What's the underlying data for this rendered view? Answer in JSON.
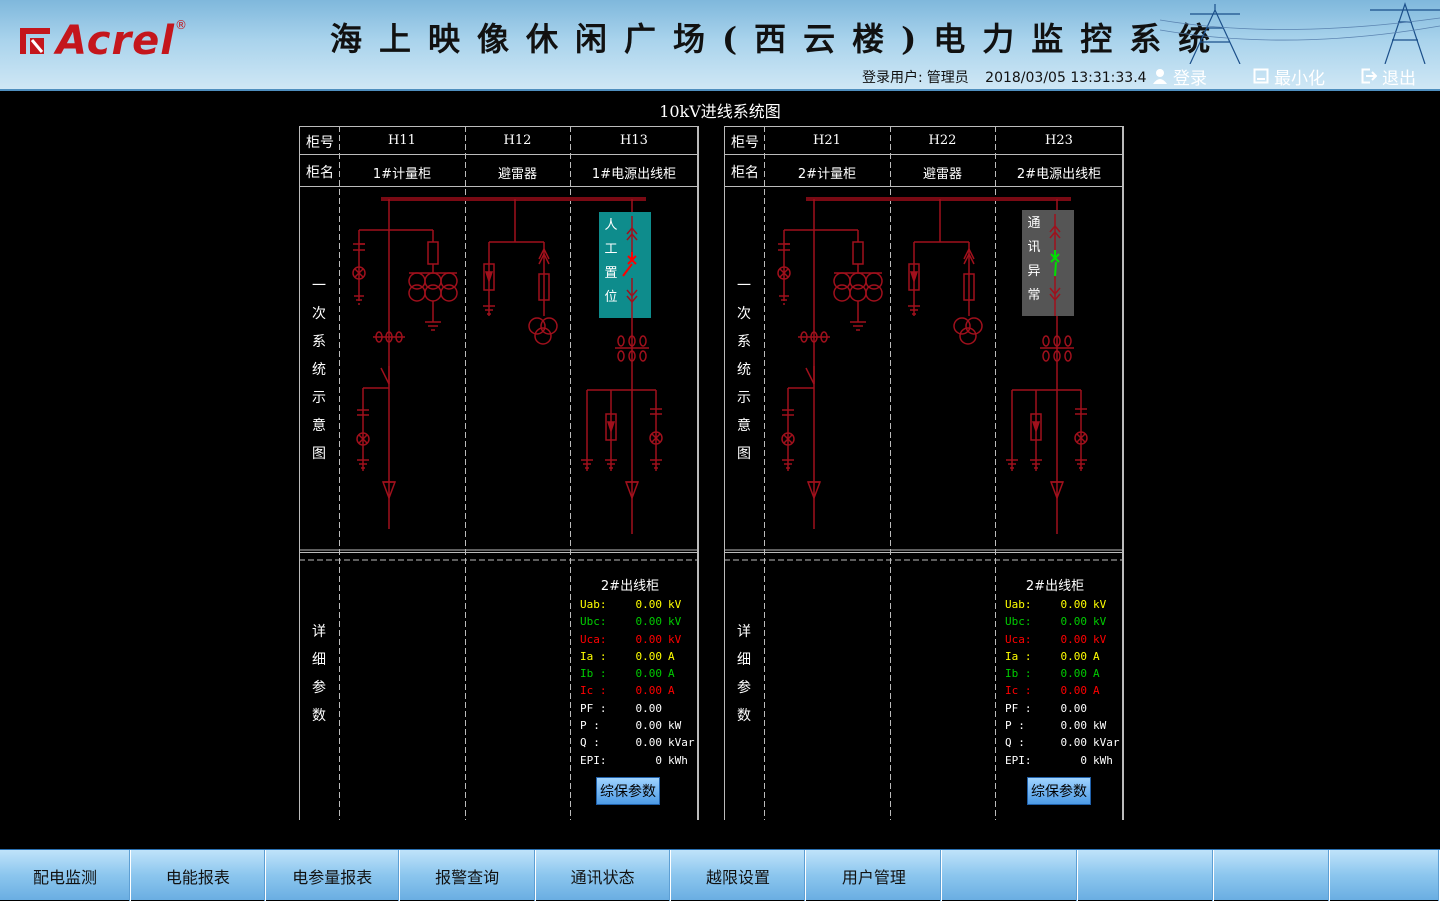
{
  "app": {
    "brand": "Acrel",
    "brand_reg": "®",
    "title": "海上映像休闲广场(西云楼)电力监控系统",
    "login_user_label": "登录用户:",
    "login_user": "管理员",
    "datetime": "2018/03/05 13:31:33.4",
    "login_button": "登录",
    "minimize_button": "最小化",
    "exit_button": "退出"
  },
  "page_title": "10kV进线系统图",
  "panels": [
    {
      "row_labels": {
        "cabinet_no": "柜号",
        "cabinet_name": "柜名",
        "diagram": "一次系统示意图",
        "details": "详细参数"
      },
      "cabinets": [
        {
          "no": "H11",
          "name": "1#计量柜"
        },
        {
          "no": "H12",
          "name": "避雷器"
        },
        {
          "no": "H13",
          "name": "1#电源出线柜"
        }
      ],
      "status_text": "人工置位",
      "status_color": "#0e8c8c",
      "params_title": "2#出线柜",
      "params": [
        {
          "label": "Uab:",
          "value": "0.00",
          "unit": "kV",
          "color": "#ffff00"
        },
        {
          "label": "Ubc:",
          "value": "0.00",
          "unit": "kV",
          "color": "#00cc00"
        },
        {
          "label": "Uca:",
          "value": "0.00",
          "unit": "kV",
          "color": "#ff0000"
        },
        {
          "label": "Ia :",
          "value": "0.00",
          "unit": "A",
          "color": "#ffff00"
        },
        {
          "label": "Ib :",
          "value": "0.00",
          "unit": "A",
          "color": "#00cc00"
        },
        {
          "label": "Ic :",
          "value": "0.00",
          "unit": "A",
          "color": "#ff0000"
        },
        {
          "label": "PF :",
          "value": "0.00",
          "unit": "",
          "color": "#ffffff"
        },
        {
          "label": "P  :",
          "value": "0.00",
          "unit": "kW",
          "color": "#ffffff"
        },
        {
          "label": "Q  :",
          "value": "0.00",
          "unit": "kVar",
          "color": "#ffffff"
        },
        {
          "label": "EPI:",
          "value": "0",
          "unit": "kWh",
          "color": "#ffffff"
        }
      ],
      "params_button": "综保参数"
    },
    {
      "row_labels": {
        "cabinet_no": "柜号",
        "cabinet_name": "柜名",
        "diagram": "一次系统示意图",
        "details": "详细参数"
      },
      "cabinets": [
        {
          "no": "H21",
          "name": "2#计量柜"
        },
        {
          "no": "H22",
          "name": "避雷器"
        },
        {
          "no": "H23",
          "name": "2#电源出线柜"
        }
      ],
      "status_text": "通讯异常",
      "status_color": "#555555",
      "params_title": "2#出线柜",
      "params": [
        {
          "label": "Uab:",
          "value": "0.00",
          "unit": "kV",
          "color": "#ffff00"
        },
        {
          "label": "Ubc:",
          "value": "0.00",
          "unit": "kV",
          "color": "#00cc00"
        },
        {
          "label": "Uca:",
          "value": "0.00",
          "unit": "kV",
          "color": "#ff0000"
        },
        {
          "label": "Ia :",
          "value": "0.00",
          "unit": "A",
          "color": "#ffff00"
        },
        {
          "label": "Ib :",
          "value": "0.00",
          "unit": "A",
          "color": "#00cc00"
        },
        {
          "label": "Ic :",
          "value": "0.00",
          "unit": "A",
          "color": "#ff0000"
        },
        {
          "label": "PF :",
          "value": "0.00",
          "unit": "",
          "color": "#ffffff"
        },
        {
          "label": "P  :",
          "value": "0.00",
          "unit": "kW",
          "color": "#ffffff"
        },
        {
          "label": "Q  :",
          "value": "0.00",
          "unit": "kVar",
          "color": "#ffffff"
        },
        {
          "label": "EPI:",
          "value": "0",
          "unit": "kWh",
          "color": "#ffffff"
        }
      ],
      "params_button": "综保参数"
    }
  ],
  "nav": [
    {
      "label": "配电监测"
    },
    {
      "label": "电能报表"
    },
    {
      "label": "电参量报表"
    },
    {
      "label": "报警查询"
    },
    {
      "label": "通讯状态"
    },
    {
      "label": "越限设置"
    },
    {
      "label": "用户管理"
    },
    {
      "label": ""
    },
    {
      "label": ""
    },
    {
      "label": ""
    },
    {
      "label": ""
    }
  ],
  "colors": {
    "busbar": "#7a0a14",
    "line": "#a0101c",
    "breaker_closed": "#ff0000",
    "breaker_open": "#00e000"
  }
}
